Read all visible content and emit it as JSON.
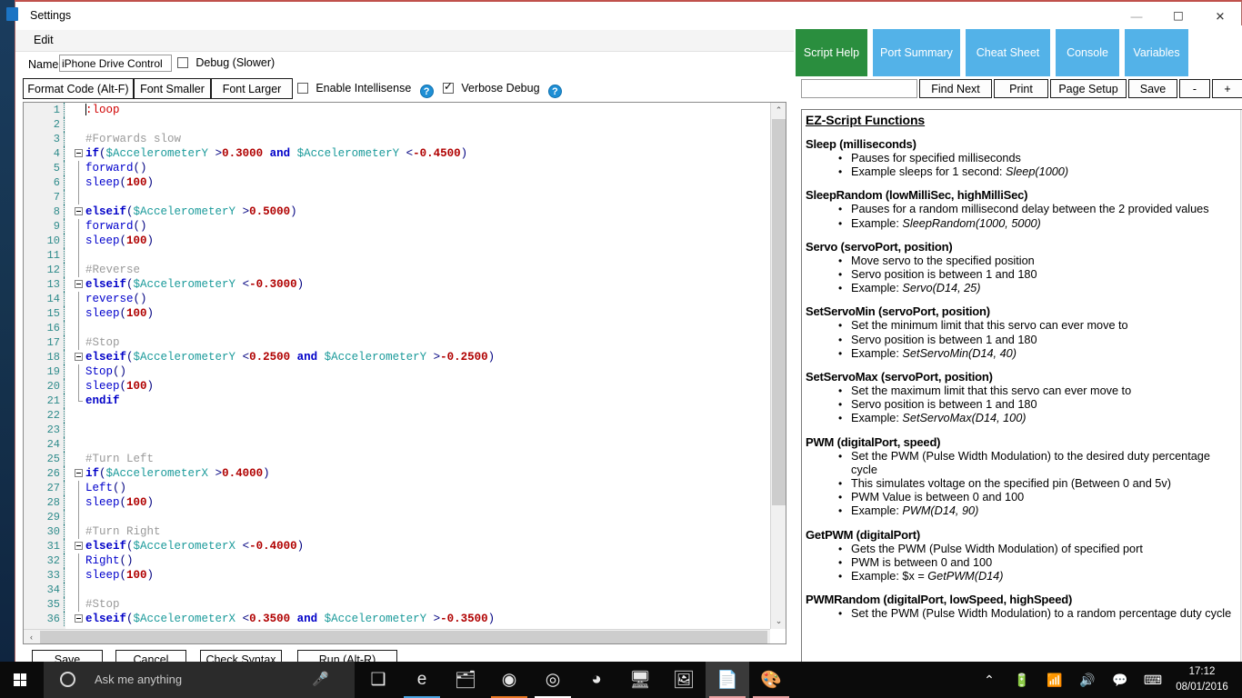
{
  "window": {
    "title": "Settings",
    "menu": {
      "edit": "Edit"
    },
    "controls": {
      "minimize": "—",
      "maximize": "☐",
      "close": "✕"
    }
  },
  "form": {
    "name_label": "Name",
    "name_value": "iPhone Drive Control",
    "debug_label": "Debug (Slower)",
    "debug_checked": false
  },
  "toolbar": {
    "format_code": "Format Code (Alt-F)",
    "font_smaller": "Font Smaller",
    "font_larger": "Font Larger",
    "intellisense_label": "Enable Intellisense",
    "intellisense_checked": false,
    "verbose_label": "Verbose Debug",
    "verbose_checked": true,
    "help_glyph": "?"
  },
  "editor": {
    "lines": [
      {
        "n": 1,
        "fold": "start-label",
        "tokens": [
          {
            "t": ":loop",
            "c": "lbl-red"
          }
        ]
      },
      {
        "n": 2,
        "fold": "",
        "tokens": []
      },
      {
        "n": 3,
        "fold": "",
        "tokens": [
          {
            "t": "#Forwards slow",
            "c": "cmt"
          }
        ]
      },
      {
        "n": 4,
        "fold": "box",
        "tokens": [
          {
            "t": "if",
            "c": "kw"
          },
          {
            "t": "(",
            "c": "op"
          },
          {
            "t": "$AccelerometerY",
            "c": "var"
          },
          {
            "t": " >",
            "c": "op"
          },
          {
            "t": "0.3000",
            "c": "num"
          },
          {
            "t": " and ",
            "c": "kw"
          },
          {
            "t": "$AccelerometerY",
            "c": "var"
          },
          {
            "t": " <",
            "c": "op"
          },
          {
            "t": "-0.4500",
            "c": "num"
          },
          {
            "t": ")",
            "c": "op"
          }
        ]
      },
      {
        "n": 5,
        "fold": "line",
        "tokens": [
          {
            "t": "forward",
            "c": "fn"
          },
          {
            "t": "()",
            "c": "op"
          }
        ]
      },
      {
        "n": 6,
        "fold": "line",
        "tokens": [
          {
            "t": "sleep",
            "c": "fn"
          },
          {
            "t": "(",
            "c": "op"
          },
          {
            "t": "100",
            "c": "num"
          },
          {
            "t": ")",
            "c": "op"
          }
        ]
      },
      {
        "n": 7,
        "fold": "line",
        "tokens": []
      },
      {
        "n": 8,
        "fold": "box",
        "tokens": [
          {
            "t": "elseif",
            "c": "kw"
          },
          {
            "t": "(",
            "c": "op"
          },
          {
            "t": "$AccelerometerY",
            "c": "var"
          },
          {
            "t": " >",
            "c": "op"
          },
          {
            "t": "0.5000",
            "c": "num"
          },
          {
            "t": ")",
            "c": "op"
          }
        ]
      },
      {
        "n": 9,
        "fold": "line",
        "tokens": [
          {
            "t": "forward",
            "c": "fn"
          },
          {
            "t": "()",
            "c": "op"
          }
        ]
      },
      {
        "n": 10,
        "fold": "line",
        "tokens": [
          {
            "t": "sleep",
            "c": "fn"
          },
          {
            "t": "(",
            "c": "op"
          },
          {
            "t": "100",
            "c": "num"
          },
          {
            "t": ")",
            "c": "op"
          }
        ]
      },
      {
        "n": 11,
        "fold": "line",
        "tokens": []
      },
      {
        "n": 12,
        "fold": "line",
        "tokens": [
          {
            "t": "#Reverse",
            "c": "cmt"
          }
        ]
      },
      {
        "n": 13,
        "fold": "box",
        "tokens": [
          {
            "t": "elseif",
            "c": "kw"
          },
          {
            "t": "(",
            "c": "op"
          },
          {
            "t": "$AccelerometerY",
            "c": "var"
          },
          {
            "t": " <",
            "c": "op"
          },
          {
            "t": "-0.3000",
            "c": "num"
          },
          {
            "t": ")",
            "c": "op"
          }
        ]
      },
      {
        "n": 14,
        "fold": "line",
        "tokens": [
          {
            "t": "reverse",
            "c": "fn"
          },
          {
            "t": "()",
            "c": "op"
          }
        ]
      },
      {
        "n": 15,
        "fold": "line",
        "tokens": [
          {
            "t": "sleep",
            "c": "fn"
          },
          {
            "t": "(",
            "c": "op"
          },
          {
            "t": "100",
            "c": "num"
          },
          {
            "t": ")",
            "c": "op"
          }
        ]
      },
      {
        "n": 16,
        "fold": "line",
        "tokens": []
      },
      {
        "n": 17,
        "fold": "line",
        "tokens": [
          {
            "t": "#Stop",
            "c": "cmt"
          }
        ]
      },
      {
        "n": 18,
        "fold": "box",
        "tokens": [
          {
            "t": "elseif",
            "c": "kw"
          },
          {
            "t": "(",
            "c": "op"
          },
          {
            "t": "$AccelerometerY",
            "c": "var"
          },
          {
            "t": " <",
            "c": "op"
          },
          {
            "t": "0.2500",
            "c": "num"
          },
          {
            "t": " and ",
            "c": "kw"
          },
          {
            "t": "$AccelerometerY",
            "c": "var"
          },
          {
            "t": " >",
            "c": "op"
          },
          {
            "t": "-0.2500",
            "c": "num"
          },
          {
            "t": ")",
            "c": "op"
          }
        ]
      },
      {
        "n": 19,
        "fold": "line",
        "tokens": [
          {
            "t": "Stop",
            "c": "fn"
          },
          {
            "t": "()",
            "c": "op"
          }
        ]
      },
      {
        "n": 20,
        "fold": "line",
        "tokens": [
          {
            "t": "sleep",
            "c": "fn"
          },
          {
            "t": "(",
            "c": "op"
          },
          {
            "t": "100",
            "c": "num"
          },
          {
            "t": ")",
            "c": "op"
          }
        ]
      },
      {
        "n": 21,
        "fold": "end",
        "tokens": [
          {
            "t": "endif",
            "c": "kw"
          }
        ]
      },
      {
        "n": 22,
        "fold": "",
        "tokens": []
      },
      {
        "n": 23,
        "fold": "",
        "tokens": []
      },
      {
        "n": 24,
        "fold": "",
        "tokens": []
      },
      {
        "n": 25,
        "fold": "",
        "tokens": [
          {
            "t": "#Turn Left",
            "c": "cmt"
          }
        ]
      },
      {
        "n": 26,
        "fold": "box",
        "tokens": [
          {
            "t": "if",
            "c": "kw"
          },
          {
            "t": "(",
            "c": "op"
          },
          {
            "t": "$AccelerometerX",
            "c": "var"
          },
          {
            "t": " >",
            "c": "op"
          },
          {
            "t": "0.4000",
            "c": "num"
          },
          {
            "t": ")",
            "c": "op"
          }
        ]
      },
      {
        "n": 27,
        "fold": "line",
        "tokens": [
          {
            "t": "Left",
            "c": "fn"
          },
          {
            "t": "()",
            "c": "op"
          }
        ]
      },
      {
        "n": 28,
        "fold": "line",
        "tokens": [
          {
            "t": "sleep",
            "c": "fn"
          },
          {
            "t": "(",
            "c": "op"
          },
          {
            "t": "100",
            "c": "num"
          },
          {
            "t": ")",
            "c": "op"
          }
        ]
      },
      {
        "n": 29,
        "fold": "line",
        "tokens": []
      },
      {
        "n": 30,
        "fold": "line",
        "tokens": [
          {
            "t": "#Turn Right",
            "c": "cmt"
          }
        ]
      },
      {
        "n": 31,
        "fold": "box",
        "tokens": [
          {
            "t": "elseif",
            "c": "kw"
          },
          {
            "t": "(",
            "c": "op"
          },
          {
            "t": "$AccelerometerX",
            "c": "var"
          },
          {
            "t": " <",
            "c": "op"
          },
          {
            "t": "-0.4000",
            "c": "num"
          },
          {
            "t": ")",
            "c": "op"
          }
        ]
      },
      {
        "n": 32,
        "fold": "line",
        "tokens": [
          {
            "t": "Right",
            "c": "fn"
          },
          {
            "t": "()",
            "c": "op"
          }
        ]
      },
      {
        "n": 33,
        "fold": "line",
        "tokens": [
          {
            "t": "sleep",
            "c": "fn"
          },
          {
            "t": "(",
            "c": "op"
          },
          {
            "t": "100",
            "c": "num"
          },
          {
            "t": ")",
            "c": "op"
          }
        ]
      },
      {
        "n": 34,
        "fold": "line",
        "tokens": []
      },
      {
        "n": 35,
        "fold": "line",
        "tokens": [
          {
            "t": "#Stop",
            "c": "cmt"
          }
        ]
      },
      {
        "n": 36,
        "fold": "box",
        "tokens": [
          {
            "t": "elseif",
            "c": "kw"
          },
          {
            "t": "(",
            "c": "op"
          },
          {
            "t": "$AccelerometerX",
            "c": "var"
          },
          {
            "t": " <",
            "c": "op"
          },
          {
            "t": "0.3500",
            "c": "num"
          },
          {
            "t": " and ",
            "c": "kw"
          },
          {
            "t": "$AccelerometerY",
            "c": "var"
          },
          {
            "t": " >",
            "c": "op"
          },
          {
            "t": "-0.3500",
            "c": "num"
          },
          {
            "t": ")",
            "c": "op"
          }
        ]
      }
    ]
  },
  "bottom_buttons": {
    "save": "Save",
    "cancel": "Cancel",
    "check_syntax": "Check Syntax",
    "run": "Run (Alt-R)"
  },
  "right_panel": {
    "tabs": [
      {
        "label": "Script Help",
        "active": true
      },
      {
        "label": "Port Summary",
        "active": false
      },
      {
        "label": "Cheat Sheet",
        "active": false
      },
      {
        "label": "Console",
        "active": false
      },
      {
        "label": "Variables",
        "active": false
      }
    ],
    "find_value": "",
    "find_placeholder": "",
    "find_next": "Find Next",
    "print": "Print",
    "page_setup": "Page Setup",
    "save": "Save",
    "zoom_out": "-",
    "zoom_in": "+",
    "doc_title": "EZ-Script Functions",
    "functions": [
      {
        "name": "Sleep (milliseconds)",
        "bullets": [
          {
            "text": "Pauses for specified milliseconds"
          },
          {
            "text": "Example sleeps for 1 second: ",
            "example": "Sleep(1000)"
          }
        ]
      },
      {
        "name": "SleepRandom (lowMilliSec, highMilliSec)",
        "bullets": [
          {
            "text": "Pauses for a random millisecond delay between the 2 provided values"
          },
          {
            "text": "Example: ",
            "example": "SleepRandom(1000, 5000)"
          }
        ]
      },
      {
        "name": "Servo (servoPort, position)",
        "bullets": [
          {
            "text": "Move servo to the specified position"
          },
          {
            "text": "Servo position is between 1 and 180"
          },
          {
            "text": "Example: ",
            "example": "Servo(D14, 25)"
          }
        ]
      },
      {
        "name": "SetServoMin (servoPort, position)",
        "bullets": [
          {
            "text": "Set the minimum limit that this servo can ever move to"
          },
          {
            "text": "Servo position is between 1 and 180"
          },
          {
            "text": "Example: ",
            "example": "SetServoMin(D14, 40)"
          }
        ]
      },
      {
        "name": "SetServoMax (servoPort, position)",
        "bullets": [
          {
            "text": "Set the maximum limit that this servo can ever move to"
          },
          {
            "text": "Servo position is between 1 and 180"
          },
          {
            "text": "Example: ",
            "example": "SetServoMax(D14, 100)"
          }
        ]
      },
      {
        "name": "PWM (digitalPort, speed)",
        "bullets": [
          {
            "text": "Set the PWM (Pulse Width Modulation) to the desired duty percentage cycle"
          },
          {
            "text": "This simulates voltage on the specified pin (Between 0 and 5v)"
          },
          {
            "text": "PWM Value is between 0 and 100"
          },
          {
            "text": "Example: ",
            "example": "PWM(D14, 90)"
          }
        ]
      },
      {
        "name": "GetPWM (digitalPort)",
        "bullets": [
          {
            "text": "Gets the PWM (Pulse Width Modulation) of specified port"
          },
          {
            "text": "PWM is between 0 and 100"
          },
          {
            "text": "Example: $x = ",
            "example": "GetPWM(D14)"
          }
        ]
      },
      {
        "name": "PWMRandom (digitalPort, lowSpeed, highSpeed)",
        "bullets": [
          {
            "text": "Set the PWM (Pulse Width Modulation) to a random percentage duty cycle"
          }
        ]
      }
    ]
  },
  "taskbar": {
    "search_placeholder": "Ask me anything",
    "icons": [
      {
        "name": "task-view-icon",
        "glyph": "❑",
        "accent": ""
      },
      {
        "name": "edge-browser-icon",
        "glyph": "e",
        "accent": "#4aa3e0"
      },
      {
        "name": "file-explorer-icon",
        "glyph": "🗂",
        "accent": ""
      },
      {
        "name": "firefox-icon",
        "glyph": "◉",
        "accent": "#e87722"
      },
      {
        "name": "ez-builder-icon",
        "glyph": "◎",
        "accent": "#ffffff"
      },
      {
        "name": "media-player-icon",
        "glyph": "◕",
        "accent": ""
      },
      {
        "name": "remote-desktop-icon",
        "glyph": "🖥",
        "accent": ""
      },
      {
        "name": "photos-icon",
        "glyph": "🖼",
        "accent": ""
      },
      {
        "name": "document-icon",
        "glyph": "📄",
        "accent": "#e8a0a0"
      },
      {
        "name": "paint-icon",
        "glyph": "🎨",
        "accent": "#e8a0a0"
      }
    ],
    "tray": {
      "chevron": "⌃",
      "battery": "🔋",
      "wifi": "📶",
      "volume": "🔊",
      "action_center": "💬",
      "keyboard": "⌨"
    },
    "time": "17:12",
    "date": "08/01/2016"
  },
  "colors": {
    "tab_active": "#2a8e3e",
    "tab_inactive": "#53b2e8",
    "titlebar_accent": "#c0514c",
    "keyword": "#0000c8",
    "variable": "#1a9a9a",
    "number": "#b00000",
    "comment": "#9a9a9a",
    "line_number": "#2e8b8b"
  }
}
